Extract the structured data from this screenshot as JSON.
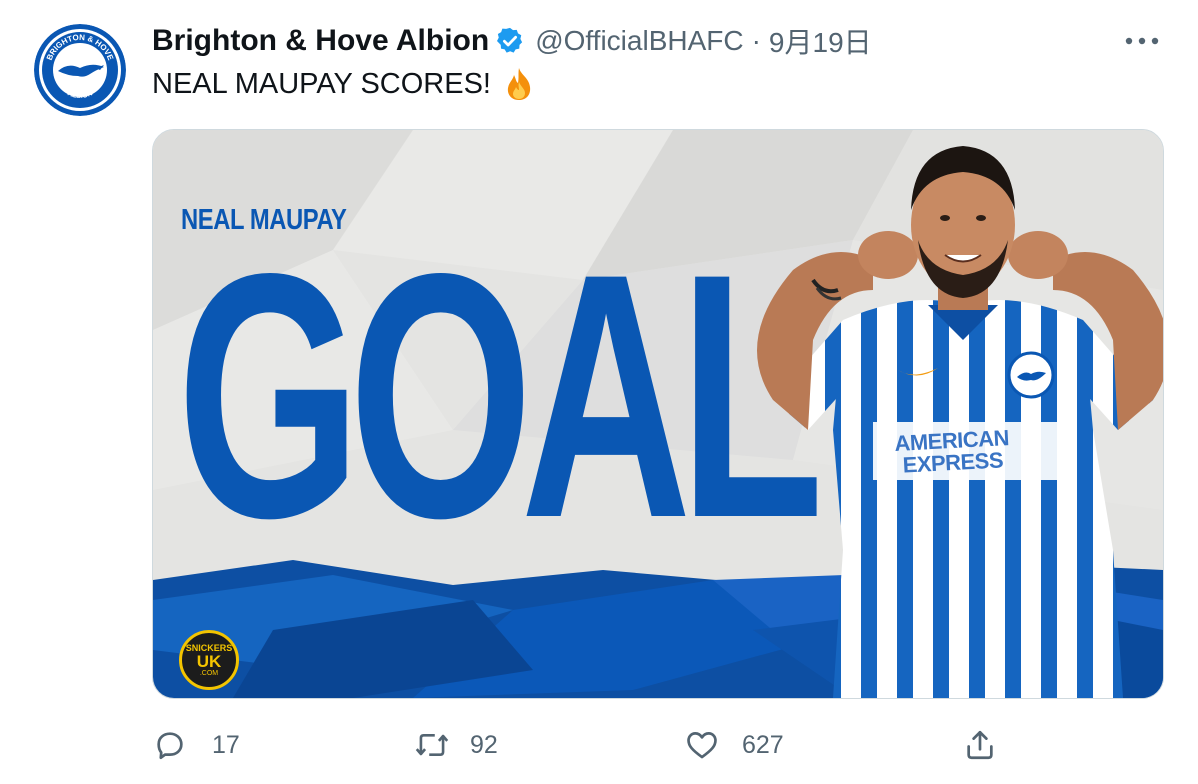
{
  "tweet": {
    "author_name": "Brighton & Hove Albion",
    "handle": "@OfficialBHAFC",
    "separator": "·",
    "timestamp": "9月19日",
    "text": "NEAL MAUPAY SCORES!"
  },
  "avatar": {
    "crest_top_text": "BRIGHTON & HOVE",
    "crest_bottom_text": "ALBION"
  },
  "media": {
    "player_name": "NEAL MAUPAY",
    "headline": "GOAL",
    "sponsor_line1": "SNICKERS",
    "sponsor_line2": "UK",
    "sponsor_line3": ".COM",
    "shirt_sponsor_line1": "AMERICAN",
    "shirt_sponsor_line2": "EXPRESS"
  },
  "actions": {
    "reply_count": "17",
    "retweet_count": "92",
    "like_count": "627"
  },
  "colors": {
    "brand_blue": "#0a57b3",
    "verified_blue": "#1d9bf0",
    "muted_text": "#536471"
  },
  "icons": [
    "verified-badge-icon",
    "more-icon",
    "fire-emoji-icon",
    "reply-icon",
    "retweet-icon",
    "like-icon",
    "share-icon"
  ]
}
